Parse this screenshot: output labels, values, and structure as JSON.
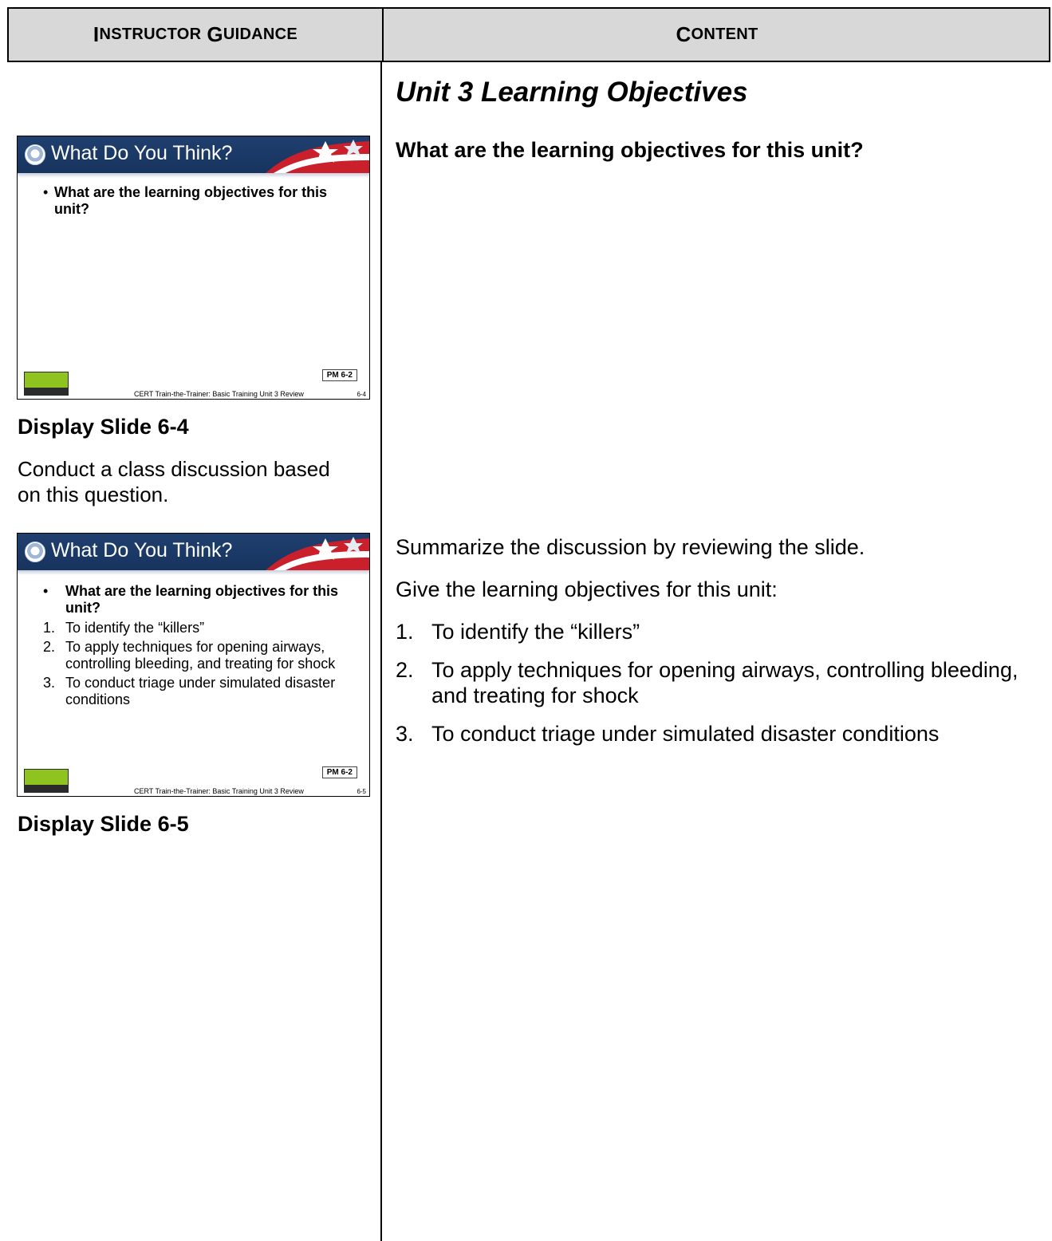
{
  "header": {
    "left_first": "I",
    "left_rest": "NSTRUCTOR",
    "left_first2": "G",
    "left_rest2": "UIDANCE",
    "right_first": "C",
    "right_rest": "ONTENT"
  },
  "slide1": {
    "title": "What Do You Think?",
    "question": "What are the learning objectives for this unit?",
    "pm": "PM 6-2",
    "footer": "CERT Train-the-Trainer: Basic Training Unit 3 Review",
    "number": "6-4",
    "logo": "CERT"
  },
  "slide2": {
    "title": "What Do You Think?",
    "question": "What are the learning objectives for this unit?",
    "items": [
      {
        "n": "1.",
        "text": "To identify the “killers”"
      },
      {
        "n": "2.",
        "text": "To apply techniques for opening airways, controlling bleeding, and treating for shock"
      },
      {
        "n": "3.",
        "text": "To conduct triage under simulated disaster conditions"
      }
    ],
    "pm": "PM 6-2",
    "footer": "CERT Train-the-Trainer: Basic Training Unit 3 Review",
    "number": "6-5",
    "logo": "CERT"
  },
  "left": {
    "caption1": "Display Slide 6-4",
    "para1": "Conduct a class discussion based on this question.",
    "caption2": "Display Slide 6-5"
  },
  "right": {
    "title": "Unit 3 Learning Objectives",
    "question": "What are the learning objectives for this unit?",
    "summary": "Summarize the discussion by reviewing the slide.",
    "intro": "Give the learning objectives for this unit:",
    "items": [
      {
        "n": "1.",
        "text": "To identify the “killers”"
      },
      {
        "n": "2.",
        "text": "To apply techniques for opening airways, controlling bleeding, and treating for shock"
      },
      {
        "n": "3.",
        "text": "To conduct triage under simulated disaster conditions"
      }
    ]
  }
}
